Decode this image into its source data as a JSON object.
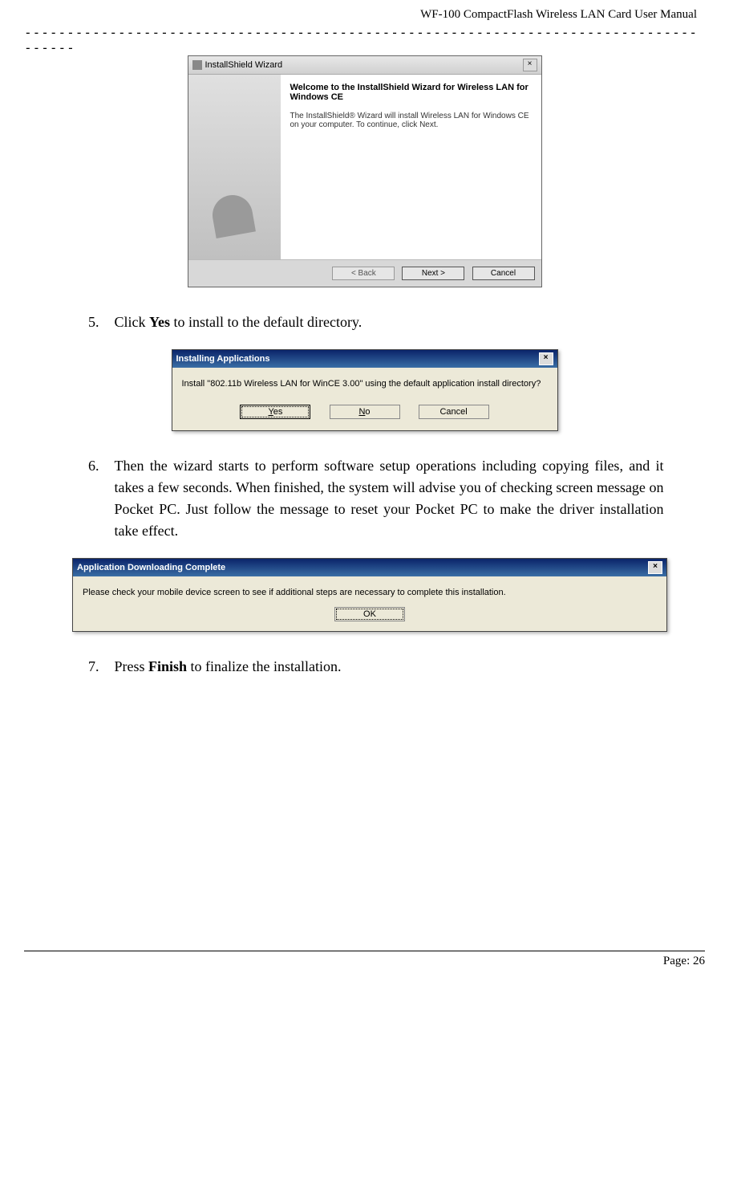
{
  "header": "WF-100 CompactFlash Wireless LAN Card User Manual",
  "dashes": "-------------------------------------------------------------------------------------",
  "dialog1": {
    "title": "InstallShield Wizard",
    "heading": "Welcome to the InstallShield Wizard for Wireless LAN for Windows CE",
    "text": "The InstallShield® Wizard will install Wireless LAN for Windows CE on your computer.  To continue, click Next.",
    "btn_back": "< Back",
    "btn_next": "Next >",
    "btn_cancel": "Cancel"
  },
  "step5": {
    "num": "5.",
    "pre": "Click ",
    "bold": "Yes",
    "post": " to install to the default directory."
  },
  "dialog2": {
    "title": "Installing Applications",
    "text": "Install \"802.11b Wireless LAN for WinCE 3.00\" using the default application install directory?",
    "btn_yes": "Yes",
    "btn_no": "No",
    "btn_cancel": "Cancel"
  },
  "step6": {
    "num": "6.",
    "text": "Then the wizard starts to perform software setup operations including copying files, and it takes a few seconds. When finished, the system will advise you of checking screen message on Pocket PC. Just follow the message to reset your Pocket PC to make the driver installation take effect."
  },
  "dialog3": {
    "title": "Application Downloading Complete",
    "text": "Please check your mobile device screen to see if additional steps are necessary to complete this installation.",
    "btn_ok": "OK"
  },
  "step7": {
    "num": "7.",
    "pre": "Press ",
    "bold": "Finish",
    "post": " to finalize the installation."
  },
  "footer": "Page: 26"
}
